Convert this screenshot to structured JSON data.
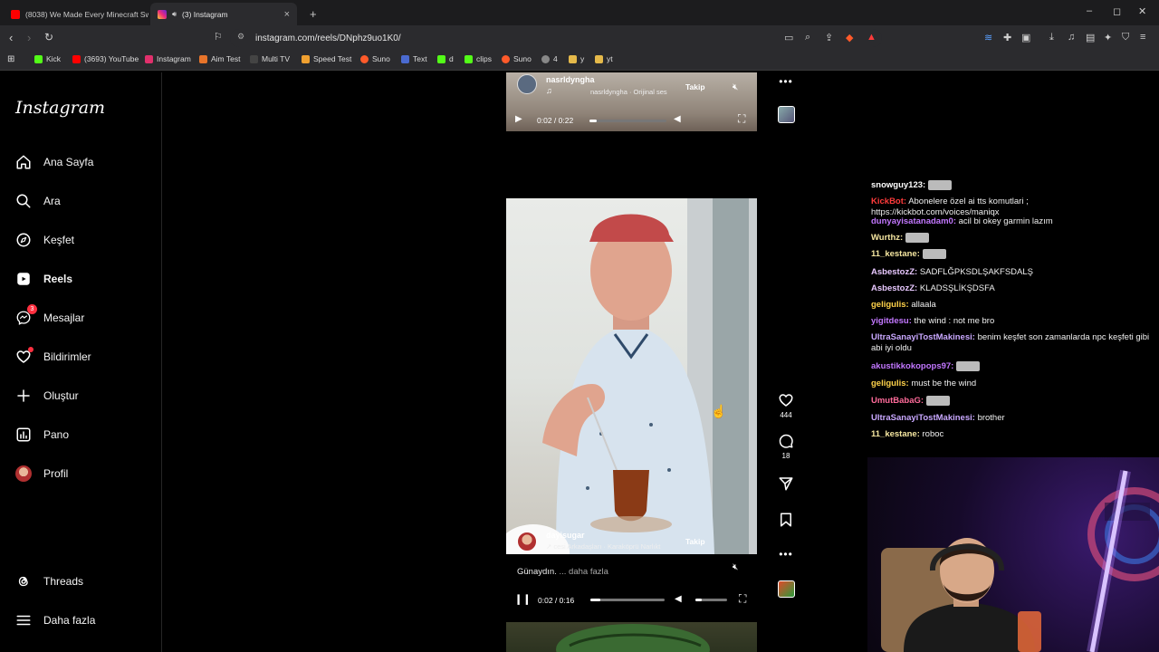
{
  "browser": {
    "tabs": [
      {
        "title": "(8038) We Made Every Minecraft Sw..."
      },
      {
        "title": "(3) Instagram"
      }
    ],
    "new_tab": "+",
    "window": {
      "minimize": "–",
      "maximize": "◻",
      "close": "✕"
    },
    "url": "instagram.com/reels/DNphz9uo1K0/",
    "bookmarks": [
      "Kick",
      "(3693) YouTube",
      "Instagram",
      "Aim Test",
      "Multi TV",
      "Speed Test",
      "Suno",
      "Text",
      "d",
      "clips",
      "Suno",
      "4",
      "y",
      "yt"
    ]
  },
  "instagram": {
    "logo": "Instagram",
    "nav": [
      {
        "label": "Ana Sayfa",
        "icon": "home-icon"
      },
      {
        "label": "Ara",
        "icon": "search-icon"
      },
      {
        "label": "Keşfet",
        "icon": "compass-icon"
      },
      {
        "label": "Reels",
        "icon": "reels-icon"
      },
      {
        "label": "Mesajlar",
        "icon": "messenger-icon",
        "badge": "3"
      },
      {
        "label": "Bildirimler",
        "icon": "heart-icon"
      },
      {
        "label": "Oluştur",
        "icon": "plus-icon"
      },
      {
        "label": "Pano",
        "icon": "dashboard-icon"
      },
      {
        "label": "Profil",
        "icon": "avatar-icon"
      }
    ],
    "bottom_nav": [
      {
        "label": "Threads",
        "icon": "threads-icon"
      },
      {
        "label": "Daha fazla",
        "icon": "menu-icon"
      }
    ]
  },
  "reels": {
    "top": {
      "username": "nasrldyngha",
      "audio": "nasrldyngha · Orijinal ses",
      "follow": "Takip",
      "time": "0:02 / 0:22",
      "progress": 0.09
    },
    "main": {
      "username": "dayisugar",
      "audio": "cesi Arkadaşları · Karaköprü Narlıkt",
      "follow": "Takip",
      "caption": "Günaydın.",
      "more": "... daha fazla",
      "time": "0:02 / 0:16",
      "progress": 0.13,
      "volume": 0.2,
      "likes": "444",
      "comments": "18"
    }
  },
  "chat": [
    {
      "user": "snowguy123:",
      "user_color": "#ffffff",
      "text": "",
      "emote": true
    },
    {
      "user": "KickBot:",
      "user_color": "#ff3b3b",
      "text": "Abonelere özel ai tts komutlari ; https://kickbot.com/voices/maniqx"
    },
    {
      "user": "dunyayisatanadam0:",
      "user_color": "#c277ff",
      "text": "acil bi okey garmin lazım"
    },
    {
      "user": "Wurthz:",
      "user_color": "#f5e6a0",
      "text": "",
      "emote": true
    },
    {
      "user": "11_kestane:",
      "user_color": "#f5e6a0",
      "text": "",
      "emote": true
    },
    {
      "user": "AsbestozZ:",
      "user_color": "#e8c8ff",
      "text": "SADFLĞPKSDLŞAKFSDALŞ"
    },
    {
      "user": "AsbestozZ:",
      "user_color": "#e8c8ff",
      "text": "KLADSŞLİKŞDSFA"
    },
    {
      "user": "geligulis:",
      "user_color": "#ffd24a",
      "text": "allaala"
    },
    {
      "user": "yigitdesu:",
      "user_color": "#c277ff",
      "text": "the wind : not me bro"
    },
    {
      "user": "UltraSanayiTostMakinesi:",
      "user_color": "#c9a8ff",
      "text": "benim keşfet son zamanlarda npc keşfeti gibi abi iyi oldu"
    },
    {
      "user": "akustikkokopops97:",
      "user_color": "#c277ff",
      "text": "",
      "emote": true
    },
    {
      "user": "geligulis:",
      "user_color": "#ffd24a",
      "text": "must be the wind"
    },
    {
      "user": "UmutBabaG:",
      "user_color": "#ff6b9a",
      "text": "",
      "emote": true
    },
    {
      "user": "UltraSanayiTostMakinesi:",
      "user_color": "#c9a8ff",
      "text": "brother"
    },
    {
      "user": "11_kestane:",
      "user_color": "#f5e6a0",
      "text": "roboc"
    }
  ],
  "colors": {
    "badge_red": "#ff3040",
    "bg": "#000000",
    "sidebar_border": "#262626"
  }
}
